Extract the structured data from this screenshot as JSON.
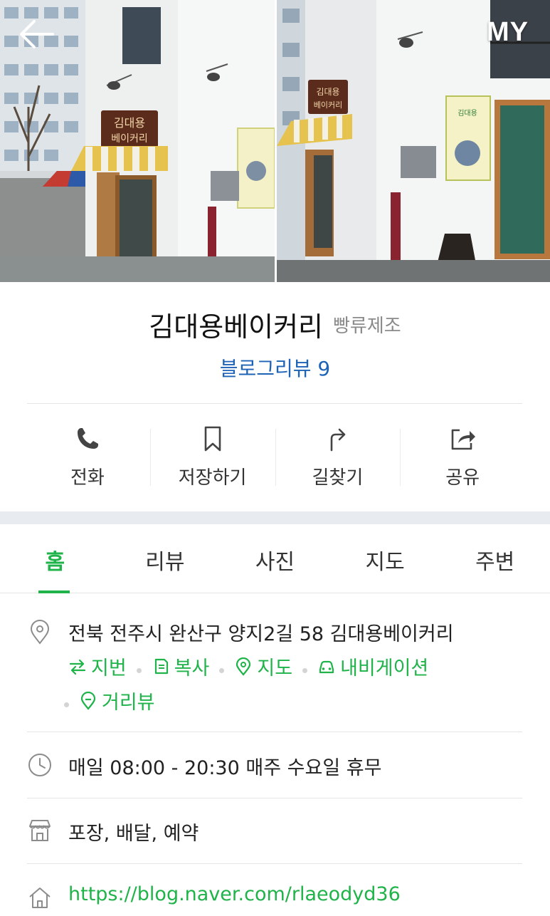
{
  "header": {
    "back_label": "←",
    "my_label": "MY"
  },
  "hero": {
    "left_photo": "bakery-storefront-photo",
    "right_photo": "bakery-storefront-photo-2"
  },
  "place": {
    "name": "김대용베이커리",
    "category": "빵류제조",
    "blog_review": "블로그리뷰 9"
  },
  "actions": [
    {
      "label": "전화",
      "icon": "phone-icon"
    },
    {
      "label": "저장하기",
      "icon": "bookmark-icon"
    },
    {
      "label": "길찾기",
      "icon": "directions-icon"
    },
    {
      "label": "공유",
      "icon": "share-icon"
    }
  ],
  "tabs": [
    {
      "label": "홈",
      "active": true
    },
    {
      "label": "리뷰",
      "active": false
    },
    {
      "label": "사진",
      "active": false
    },
    {
      "label": "지도",
      "active": false
    },
    {
      "label": "주변",
      "active": false
    }
  ],
  "address": {
    "text": "전북 전주시 완산구 양지2길 58 김대용베이커리",
    "links": [
      {
        "label": "지번",
        "icon": "swap-arrows-icon"
      },
      {
        "label": "복사",
        "icon": "copy-icon"
      },
      {
        "label": "지도",
        "icon": "map-pin-icon"
      },
      {
        "label": "내비게이션",
        "icon": "car-icon"
      },
      {
        "label": "거리뷰",
        "icon": "street-view-icon"
      }
    ]
  },
  "hours": {
    "text": "매일 08:00 - 20:30 매주 수요일 휴무"
  },
  "services": {
    "text": "포장, 배달, 예약"
  },
  "website": {
    "url": "https://blog.naver.com/rlaeodyd36"
  },
  "colors": {
    "accent_green": "#1fb34a",
    "link_blue": "#1e63b6",
    "muted_gray": "#8a8a8a"
  }
}
